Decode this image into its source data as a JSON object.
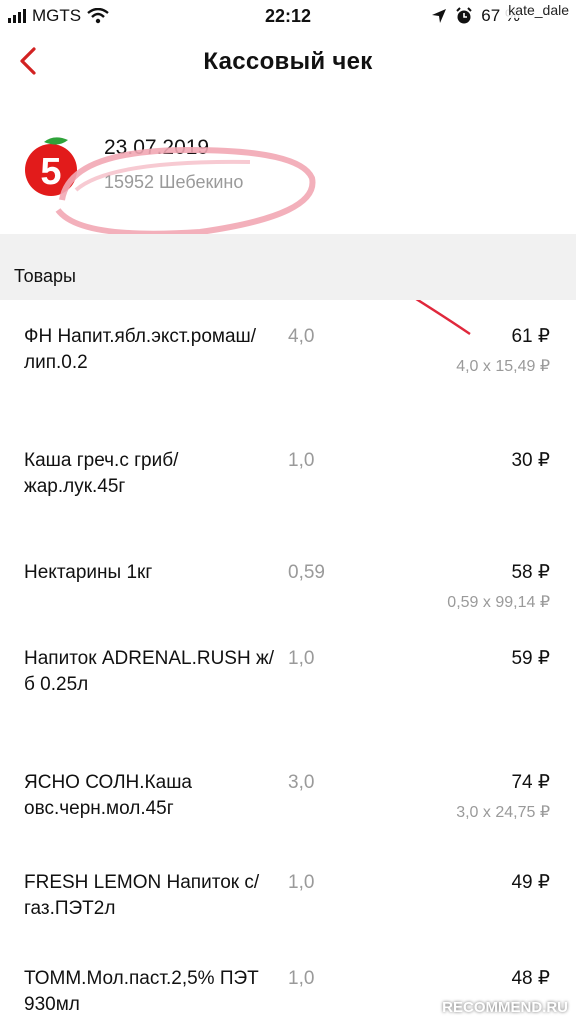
{
  "status_bar": {
    "carrier": "MGTS",
    "time": "22:12",
    "battery": "67 %",
    "user_tag": "kate_dale"
  },
  "nav": {
    "title": "Кассовый чек"
  },
  "store": {
    "date": "23.07.2019",
    "name": "15952 Шебекино"
  },
  "section_title": "Товары",
  "items": [
    {
      "name": "ФН Напит.ябл.экст.ромаш/ лип.0.2",
      "qty": "4,0",
      "price": "61 ₽",
      "calc": "4,0 x 15,49 ₽"
    },
    {
      "name": "Каша греч.с гриб/ жар.лук.45г",
      "qty": "1,0",
      "price": "30 ₽",
      "calc": ""
    },
    {
      "name": "Нектарины 1кг",
      "qty": "0,59",
      "price": "58 ₽",
      "calc": "0,59 x 99,14 ₽"
    },
    {
      "name": "Напиток ADRENAL.RUSH ж/б 0.25л",
      "qty": "1,0",
      "price": "59 ₽",
      "calc": ""
    },
    {
      "name": "ЯСНО СОЛН.Каша овс.черн.мол.45г",
      "qty": "3,0",
      "price": "74 ₽",
      "calc": "3,0 x 24,75 ₽"
    },
    {
      "name": "FRESH LEMON Напиток с/газ.ПЭТ2л",
      "qty": "1,0",
      "price": "49 ₽",
      "calc": ""
    },
    {
      "name": "ТОММ.Мол.паст.2,5% ПЭТ 930мл",
      "qty": "1,0",
      "price": "48 ₽",
      "calc": ""
    }
  ],
  "watermark": "RECOMMEND.RU",
  "colors": {
    "accent": "#d22222",
    "muted": "#9a9a9a",
    "section_bg": "#f1f1f1"
  }
}
